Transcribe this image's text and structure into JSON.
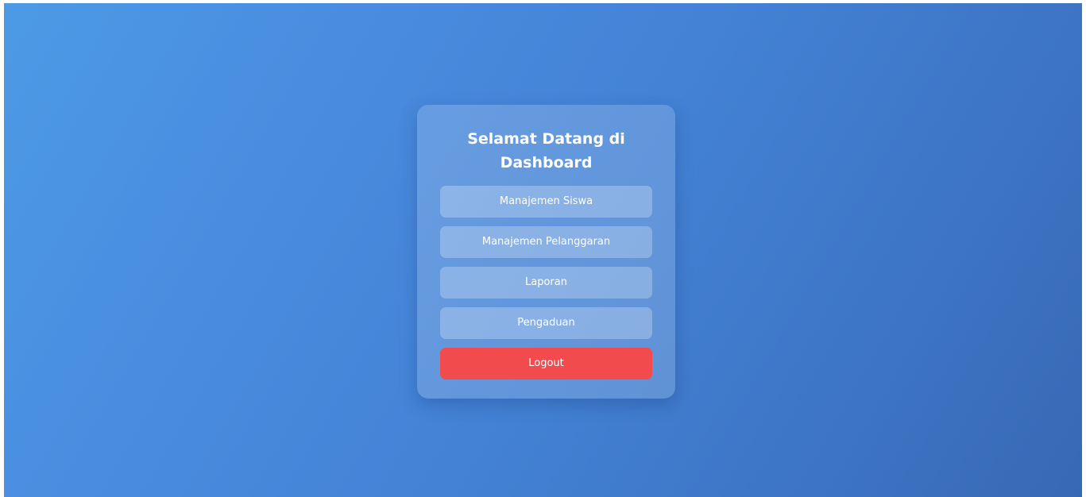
{
  "dashboard": {
    "title": "Selamat Datang di Dashboard",
    "menu": [
      {
        "label": "Manajemen Siswa"
      },
      {
        "label": "Manajemen Pelanggaran"
      },
      {
        "label": "Laporan"
      },
      {
        "label": "Pengaduan"
      }
    ],
    "logout_label": "Logout"
  },
  "colors": {
    "background_start": "#4c9ae6",
    "background_end": "#3669b5",
    "logout": "#f24b4e",
    "text": "#ffffff"
  }
}
